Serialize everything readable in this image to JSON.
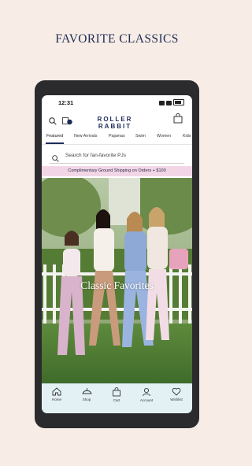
{
  "headline": "FAVORITE CLASSICS",
  "status": {
    "time": "12:31"
  },
  "app": {
    "logo": "ROLLER RABBIT"
  },
  "nav": {
    "tabs": [
      {
        "label": "Featured"
      },
      {
        "label": "New Arrivals"
      },
      {
        "label": "Pajamas"
      },
      {
        "label": "Swim"
      },
      {
        "label": "Women"
      },
      {
        "label": "Kids"
      }
    ]
  },
  "search": {
    "placeholder": "Search for fan-favorite PJs"
  },
  "promo": {
    "text": "Complimentary Ground Shipping on Orders + $100"
  },
  "hero": {
    "title": "Classic Favorites"
  },
  "bottom_nav": [
    {
      "label": "Home",
      "icon": "home-icon"
    },
    {
      "label": "Shop",
      "icon": "shop-icon"
    },
    {
      "label": "Cart",
      "icon": "cart-icon"
    },
    {
      "label": "Account",
      "icon": "account-icon"
    },
    {
      "label": "Wishlist",
      "icon": "heart-icon"
    }
  ],
  "colors": {
    "page_background": "#f7ede6",
    "headline": "#1f2c55",
    "brand_navy": "#1d2a5a",
    "promo_background": "#f2d6e6",
    "bottom_nav_background": "#e3f1f5"
  }
}
